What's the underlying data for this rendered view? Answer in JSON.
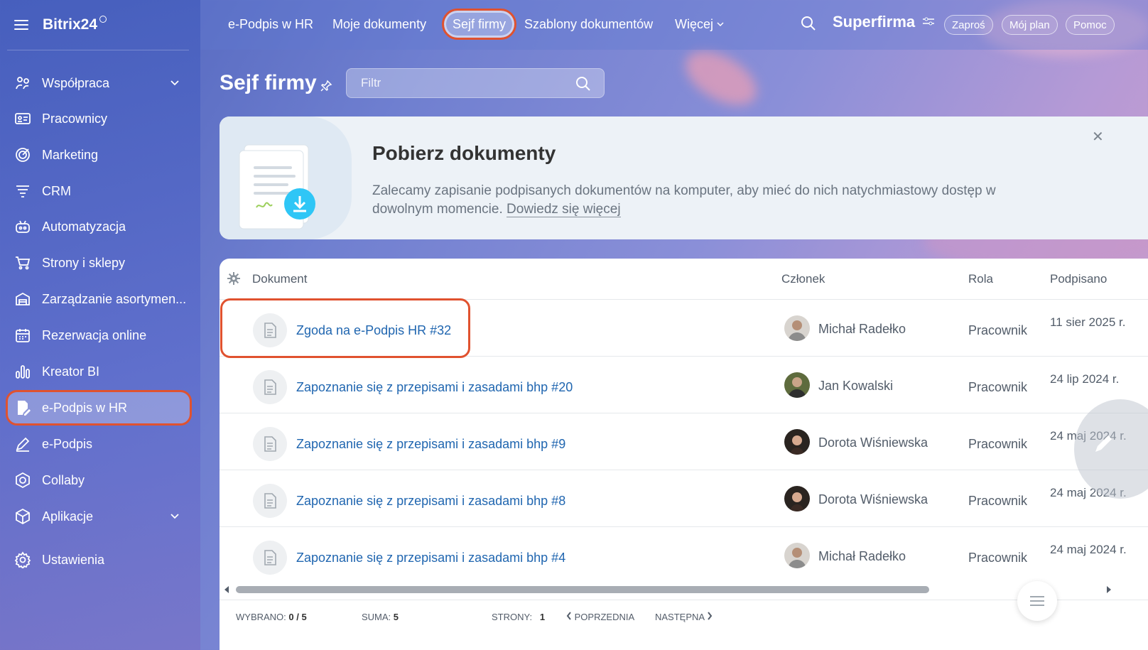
{
  "sidebar": {
    "logo": "Bitrix24",
    "items": [
      {
        "label": "Współpraca",
        "icon": "chat-icon",
        "has_chevron": true
      },
      {
        "label": "Pracownicy",
        "icon": "id-card-icon"
      },
      {
        "label": "Marketing",
        "icon": "target-icon"
      },
      {
        "label": "CRM",
        "icon": "funnel-icon"
      },
      {
        "label": "Automatyzacja",
        "icon": "robot-icon"
      },
      {
        "label": "Strony i sklepy",
        "icon": "cart-icon"
      },
      {
        "label": "Zarządzanie asortymen...",
        "icon": "warehouse-icon"
      },
      {
        "label": "Rezerwacja online",
        "icon": "calendar-icon"
      },
      {
        "label": "Kreator BI",
        "icon": "bar-chart-icon"
      },
      {
        "label": "e-Podpis w HR",
        "icon": "signature-doc-icon",
        "active": true
      },
      {
        "label": "e-Podpis",
        "icon": "pen-icon"
      },
      {
        "label": "Collaby",
        "icon": "hexagon-icon"
      },
      {
        "label": "Aplikacje",
        "icon": "cube-icon",
        "has_chevron": true
      },
      {
        "label": "Ustawienia",
        "icon": "gear-icon"
      }
    ]
  },
  "topbar": {
    "tabs": [
      {
        "label": "e-Podpis w HR"
      },
      {
        "label": "Moje dokumenty"
      },
      {
        "label": "Sejf firmy",
        "active": true
      },
      {
        "label": "Szablony dokumentów"
      },
      {
        "label": "Więcej"
      }
    ],
    "brand": "Superfirma",
    "buttons": {
      "invite": "Zaproś",
      "plan": "Mój plan",
      "help": "Pomoc"
    }
  },
  "page": {
    "title": "Sejf firmy",
    "filter_placeholder": "Filtr"
  },
  "banner": {
    "title": "Pobierz dokumenty",
    "text": "Zalecamy zapisanie podpisanych dokumentów na komputer, aby mieć do nich natychmiastowy dostęp w dowolnym momencie.",
    "link": "Dowiedz się więcej"
  },
  "table": {
    "columns": {
      "document": "Dokument",
      "member": "Członek",
      "role": "Rola",
      "signed": "Podpisano"
    },
    "rows": [
      {
        "document": "Zgoda na e-Podpis HR #32",
        "member": "Michał Radełko",
        "role": "Pracownik",
        "signed": "11 sier 2025 r."
      },
      {
        "document": "Zapoznanie się z przepisami i zasadami bhp #20",
        "member": "Jan Kowalski",
        "role": "Pracownik",
        "signed": "24 lip 2024 r."
      },
      {
        "document": "Zapoznanie się z przepisami i zasadami bhp #9",
        "member": "Dorota Wiśniewska",
        "role": "Pracownik",
        "signed": "24 maj 2024 r."
      },
      {
        "document": "Zapoznanie się z przepisami i zasadami bhp #8",
        "member": "Dorota Wiśniewska",
        "role": "Pracownik",
        "signed": "24 maj 2024 r."
      },
      {
        "document": "Zapoznanie się z przepisami i zasadami bhp #4",
        "member": "Michał Radełko",
        "role": "Pracownik",
        "signed": "24 maj 2024 r."
      }
    ]
  },
  "footer": {
    "selected_label": "WYBRANO:",
    "selected_value": "0 / 5",
    "total_label": "SUMA:",
    "total_value": "5",
    "pages_label": "STRONY:",
    "pages_value": "1",
    "prev": "POPRZEDNIA",
    "next": "NASTĘPNA"
  },
  "colors": {
    "highlight": "#e0522f",
    "link": "#2066b0",
    "accent_blue": "#2fc6f6"
  }
}
